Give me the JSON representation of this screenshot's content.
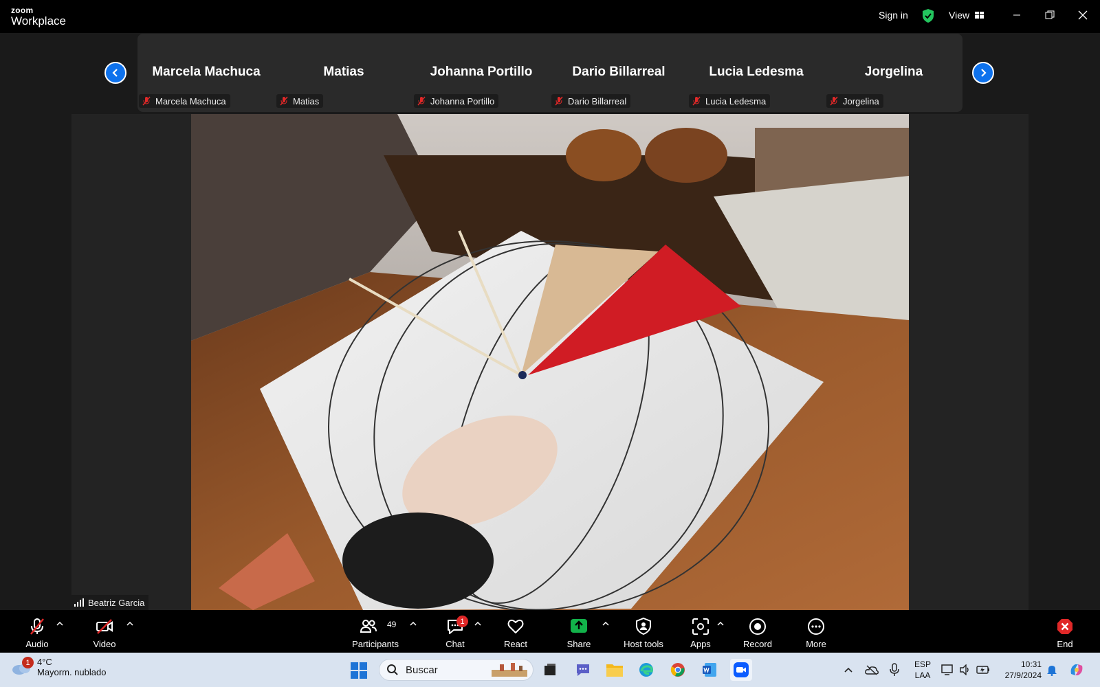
{
  "window": {
    "brand_top": "zoom",
    "brand_bottom": "Workplace",
    "sign_in": "Sign in",
    "view_label": "View"
  },
  "participants": [
    {
      "name": "Marcela Machuca",
      "label": "Marcela Machuca"
    },
    {
      "name": "Matias",
      "label": "Matias"
    },
    {
      "name": "Johanna Portillo",
      "label": "Johanna Portillo"
    },
    {
      "name": "Dario Billarreal",
      "label": "Dario Billarreal"
    },
    {
      "name": "Lucia Ledesma",
      "label": "Lucia Ledesma"
    },
    {
      "name": "Jorgelina",
      "label": "Jorgelina"
    }
  ],
  "active_speaker": "Beatriz Garcia",
  "toolbar": {
    "audio": "Audio",
    "video": "Video",
    "participants": "Participants",
    "participants_count": "49",
    "chat": "Chat",
    "chat_badge": "1",
    "react": "React",
    "share": "Share",
    "host_tools": "Host tools",
    "apps": "Apps",
    "record": "Record",
    "more": "More",
    "end": "End"
  },
  "taskbar": {
    "weather_badge": "1",
    "weather_temp": "4°C",
    "weather_desc": "Mayorm. nublado",
    "search_placeholder": "Buscar",
    "lang_top": "ESP",
    "lang_bottom": "LAA",
    "time": "10:31",
    "date": "27/9/2024"
  },
  "colors": {
    "accent_blue": "#0e72ed",
    "share_green": "#12b24a",
    "end_red": "#e02828",
    "shield_green": "#23c55e"
  }
}
